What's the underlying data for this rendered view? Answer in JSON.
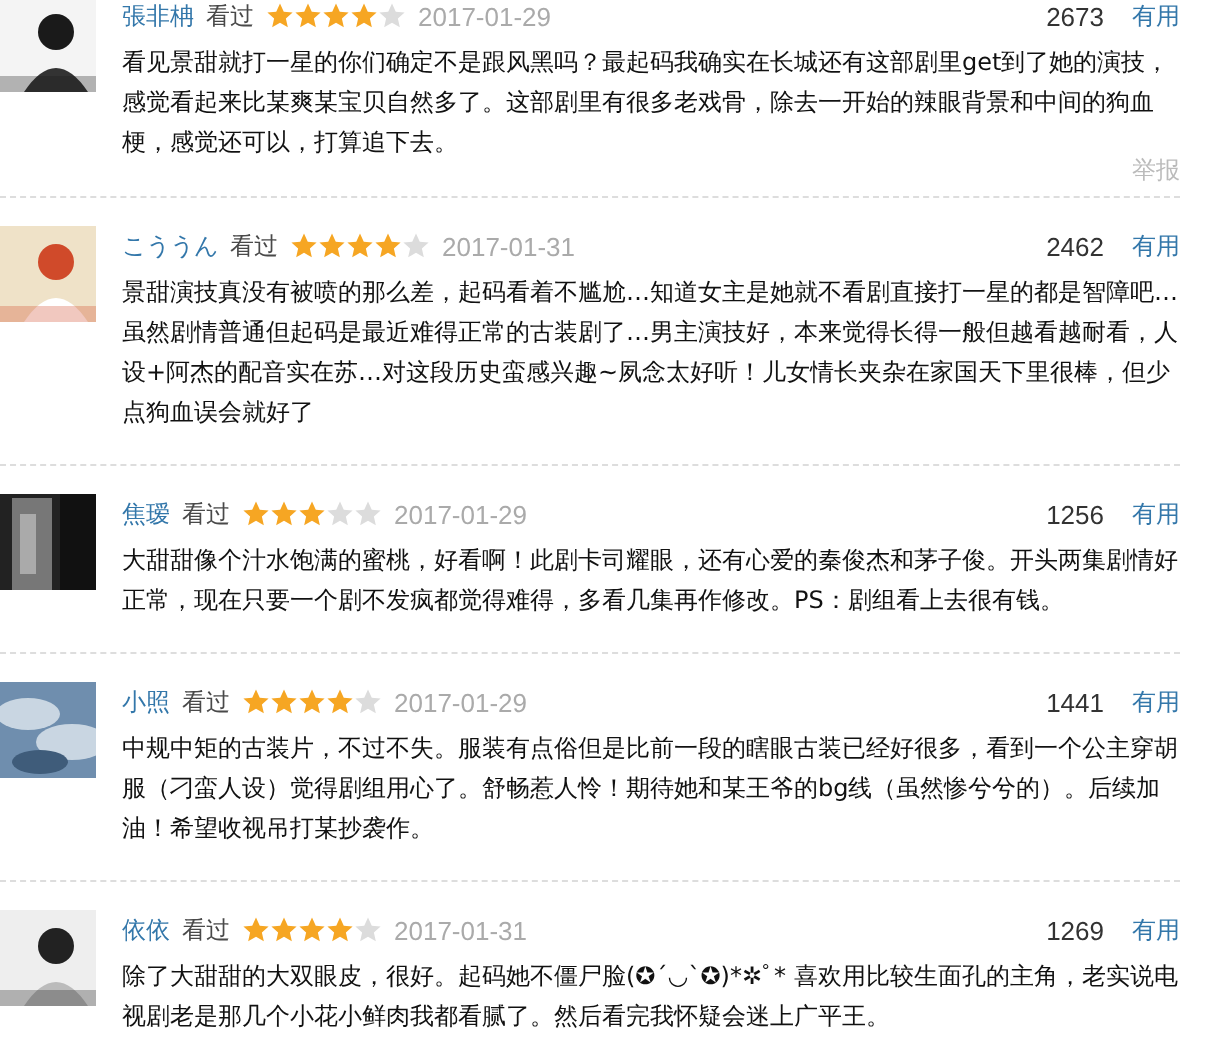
{
  "reviews": [
    {
      "user": "張非柟",
      "status": "看过",
      "stars": 4,
      "date": "2017-01-29",
      "votes": "2673",
      "useful": "有用",
      "text": "看见景甜就打一星的你们确定不是跟风黑吗？最起码我确实在长城还有这部剧里get到了她的演技，感觉看起来比某爽某宝贝自然多了。这部剧里有很多老戏骨，除去一开始的辣眼背景和中间的狗血梗，感觉还可以，打算追下去。",
      "report": "举报"
    },
    {
      "user": "こううん",
      "status": "看过",
      "stars": 4,
      "date": "2017-01-31",
      "votes": "2462",
      "useful": "有用",
      "text": "景甜演技真没有被喷的那么差，起码看着不尴尬…知道女主是她就不看剧直接打一星的都是智障吧…虽然剧情普通但起码是最近难得正常的古装剧了…男主演技好，本来觉得长得一般但越看越耐看，人设+阿杰的配音实在苏…对这段历史蛮感兴趣~夙念太好听！儿女情长夹杂在家国天下里很棒，但少点狗血误会就好了"
    },
    {
      "user": "焦瑷",
      "status": "看过",
      "stars": 3,
      "date": "2017-01-29",
      "votes": "1256",
      "useful": "有用",
      "text": "大甜甜像个汁水饱满的蜜桃，好看啊！此剧卡司耀眼，还有心爱的秦俊杰和茅子俊。开头两集剧情好正常，现在只要一个剧不发疯都觉得难得，多看几集再作修改。PS：剧组看上去很有钱。"
    },
    {
      "user": "小照",
      "status": "看过",
      "stars": 4,
      "date": "2017-01-29",
      "votes": "1441",
      "useful": "有用",
      "text": "中规中矩的古装片，不过不失。服装有点俗但是比前一段的瞎眼古装已经好很多，看到一个公主穿胡服（刁蛮人设）觉得剧组用心了。舒畅惹人怜！期待她和某王爷的bg线（虽然惨兮兮的）。后续加油！希望收视吊打某抄袭作。"
    },
    {
      "user": "依依",
      "status": "看过",
      "stars": 4,
      "date": "2017-01-31",
      "votes": "1269",
      "useful": "有用",
      "text": "除了大甜甜的大双眼皮，很好。起码她不僵尸脸(✪´◡`✪)*✲ﾟ* 喜欢用比较生面孔的主角，老实说电视剧老是那几个小花小鲜肉我都看腻了。然后看完我怀疑会迷上广平王。"
    }
  ]
}
